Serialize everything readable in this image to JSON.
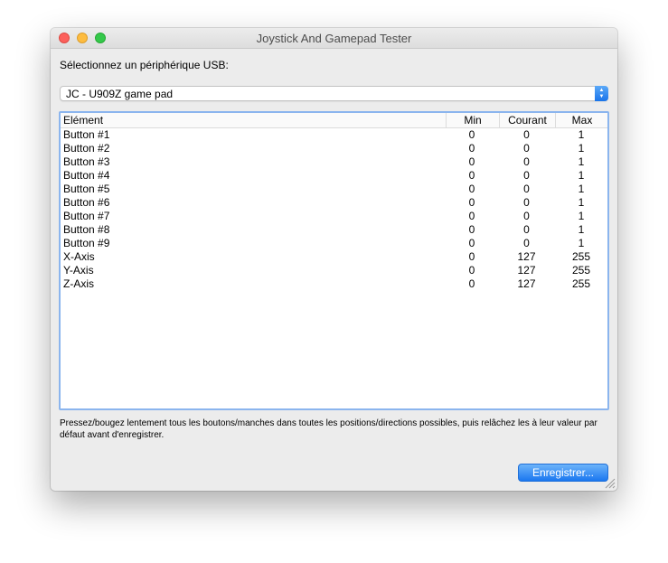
{
  "window": {
    "title": "Joystick And Gamepad Tester"
  },
  "device": {
    "label": "Sélectionnez un périphérique USB:",
    "selected": "JC - U909Z game pad"
  },
  "table": {
    "columns": {
      "element": "Elément",
      "min": "Min",
      "current": "Courant",
      "max": "Max"
    },
    "rows": [
      {
        "name": "Button #1",
        "min": "0",
        "current": "0",
        "max": "1"
      },
      {
        "name": "Button #2",
        "min": "0",
        "current": "0",
        "max": "1"
      },
      {
        "name": "Button #3",
        "min": "0",
        "current": "0",
        "max": "1"
      },
      {
        "name": "Button #4",
        "min": "0",
        "current": "0",
        "max": "1"
      },
      {
        "name": "Button #5",
        "min": "0",
        "current": "0",
        "max": "1"
      },
      {
        "name": "Button #6",
        "min": "0",
        "current": "0",
        "max": "1"
      },
      {
        "name": "Button #7",
        "min": "0",
        "current": "0",
        "max": "1"
      },
      {
        "name": "Button #8",
        "min": "0",
        "current": "0",
        "max": "1"
      },
      {
        "name": "Button #9",
        "min": "0",
        "current": "0",
        "max": "1"
      },
      {
        "name": "X-Axis",
        "min": "0",
        "current": "127",
        "max": "255"
      },
      {
        "name": "Y-Axis",
        "min": "0",
        "current": "127",
        "max": "255"
      },
      {
        "name": "Z-Axis",
        "min": "0",
        "current": "127",
        "max": "255"
      }
    ]
  },
  "hint": "Pressez/bougez lentement tous les boutons/manches dans toutes les positions/directions possibles, puis relâchez les à leur valeur par défaut avant d'enregistrer.",
  "buttons": {
    "save": "Enregistrer..."
  },
  "icons": {
    "close": "close-icon",
    "minimize": "minimize-icon",
    "zoom": "zoom-icon",
    "stepper": "chevron-up-down-icon",
    "resize": "resize-grip-icon"
  },
  "colors": {
    "accent": "#1b77f0",
    "close": "#fc605b",
    "minimize": "#fdbc40",
    "zoom": "#34c84a",
    "focus_ring": "#8bb5ee"
  }
}
